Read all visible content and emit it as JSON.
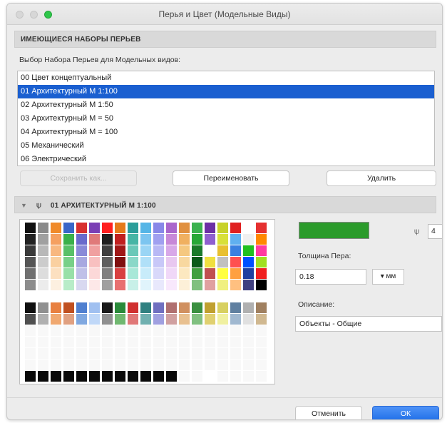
{
  "window": {
    "title": "Перья и Цвет (Модельные Виды)"
  },
  "sets_section": {
    "header": "ИМЕЮЩИЕСЯ НАБОРЫ ПЕРЬЕВ",
    "hint": "Выбор Набора Перьев для Модельных видов:",
    "items": [
      "00 Цвет концептуальный",
      "01 Архитектурный М 1:100",
      "02 Архитектурный М 1:50",
      "03 Архитектурный М = 50",
      "04 Архитектурный М = 100",
      "05 Механический",
      "06 Электрический"
    ],
    "selected_index": 1,
    "buttons": {
      "save_as": "Сохранить как...",
      "rename": "Переименовать",
      "delete": "Удалить"
    }
  },
  "pen_section": {
    "header": "01 АРХИТЕКТУРНЫЙ М 1:100",
    "current_color": "#2b9b2b",
    "pen_number": "4",
    "thickness_label": "Толщина Пера:",
    "thickness_value": "0.18",
    "unit": "мм",
    "description_label": "Описание:",
    "description_value": "Объекты - Общие"
  },
  "palette_rows": [
    [
      "#101010",
      "#8a8a8a",
      "#f08a2a",
      "#3a66c8",
      "#d83030",
      "#7b3fb5",
      "#ff2020",
      "#e57a1a",
      "#2a9d9a",
      "#55b5e6",
      "#8888e8",
      "#aa66cc",
      "#e09040",
      "#3bb24f",
      "#6c2fa5",
      "#c8d22a",
      "#e02020",
      "#ffffff",
      "#e53030"
    ],
    [
      "#222222",
      "#a0a0a0",
      "#f5a060",
      "#3ab04a",
      "#6a6acc",
      "#e07a7a",
      "#202020",
      "#c02020",
      "#46b5a5",
      "#7cc5f0",
      "#a0a0f0",
      "#c788d8",
      "#f0b060",
      "#28a838",
      "#8f5fcf",
      "#d8e03a",
      "#60b0f0",
      "#f0f0f0",
      "#ff8800"
    ],
    [
      "#3a3a3a",
      "#b8b8b8",
      "#f8b880",
      "#58c068",
      "#8a8ad8",
      "#f0a0a0",
      "#404040",
      "#a01818",
      "#6ac8b8",
      "#9ad5f5",
      "#b8b8f5",
      "#d8a8e8",
      "#f5c880",
      "#1a7a2a",
      "#ffffff",
      "#e8c030",
      "#3a80e0",
      "#20c020",
      "#ff3aa0"
    ],
    [
      "#555555",
      "#cccccc",
      "#fad0a0",
      "#78d088",
      "#a8a8e0",
      "#f8c0c0",
      "#606060",
      "#801010",
      "#8ad8c8",
      "#b0e0f8",
      "#c8c8f8",
      "#e8c8f0",
      "#f8d8a0",
      "#0a5a1a",
      "#f0e040",
      "#c0c0c0",
      "#ff5050",
      "#0050ff",
      "#a0e020"
    ],
    [
      "#707070",
      "#dddddd",
      "#fce0c0",
      "#98e0a8",
      "#c0c0e8",
      "#fcd8d8",
      "#808080",
      "#d84040",
      "#a8e8d8",
      "#c8ecfa",
      "#d8d8fa",
      "#f0d8f8",
      "#fce8c0",
      "#40a040",
      "#c05050",
      "#ffff40",
      "#ffa040",
      "#2040a0",
      "#f02020"
    ],
    [
      "#8c8c8c",
      "#ececec",
      "#fdf0e0",
      "#b8ecc8",
      "#d8d8f0",
      "#fde8e8",
      "#a0a0a0",
      "#e87070",
      "#c8f0e8",
      "#e0f4fc",
      "#e8e8fc",
      "#f8e8fc",
      "#fdf0d8",
      "#80c080",
      "#e0a0a0",
      "#f0f080",
      "#ffc080",
      "#404080",
      "#000000"
    ],
    [
      "#ffffff",
      "#ffffff",
      "#ffffff",
      "#ffffff",
      "#ffffff",
      "#ffffff",
      "#ffffff",
      "#ffffff",
      "#ffffff",
      "#ffffff",
      "#ffffff",
      "#ffffff",
      "#ffffff",
      "#ffffff",
      "#ffffff",
      "#ffffff",
      "#ffffff",
      "#ffffff",
      "#ffffff"
    ],
    [
      "#101010",
      "#909090",
      "#e88040",
      "#c05020",
      "#5080d0",
      "#a0c0f0",
      "#1a1a1a",
      "#2a8a3a",
      "#d03030",
      "#308080",
      "#7070c0",
      "#b07070",
      "#d09060",
      "#3a9040",
      "#c0a030",
      "#d8d060",
      "#6080a0",
      "#b0b0b0",
      "#a08060"
    ],
    [
      "#505050",
      "#b0b0b0",
      "#f0a870",
      "#e0a080",
      "#80a8e0",
      "#c0d8f8",
      "#909090",
      "#70b870",
      "#e07878",
      "#70b0b0",
      "#a0a0e0",
      "#d0a0a0",
      "#e8c090",
      "#80c080",
      "#e0d070",
      "#f0f0a0",
      "#a0b8d0",
      "#e0e0e0",
      "#d0b890"
    ],
    [
      "#f8f8f8",
      "#f8f8f8",
      "#f8f8f8",
      "#f8f8f8",
      "#f8f8f8",
      "#f8f8f8",
      "#f8f8f8",
      "#f8f8f8",
      "#f8f8f8",
      "#f8f8f8",
      "#f8f8f8",
      "#f8f8f8",
      "#f8f8f8",
      "#f8f8f8",
      "#f8f8f8",
      "#f8f8f8",
      "#f8f8f8",
      "#f8f8f8",
      "#f8f8f8"
    ],
    [
      "#f8f8f8",
      "#f8f8f8",
      "#f8f8f8",
      "#f8f8f8",
      "#f8f8f8",
      "#f8f8f8",
      "#f8f8f8",
      "#f8f8f8",
      "#f8f8f8",
      "#f8f8f8",
      "#f8f8f8",
      "#f8f8f8",
      "#f8f8f8",
      "#f8f8f8",
      "#f8f8f8",
      "#f8f8f8",
      "#f8f8f8",
      "#f8f8f8",
      "#f8f8f8"
    ],
    [
      "#f8f8f8",
      "#f8f8f8",
      "#f8f8f8",
      "#f8f8f8",
      "#f8f8f8",
      "#f8f8f8",
      "#f8f8f8",
      "#f8f8f8",
      "#f8f8f8",
      "#f8f8f8",
      "#f8f8f8",
      "#f8f8f8",
      "#f8f8f8",
      "#f8f8f8",
      "#f8f8f8",
      "#f8f8f8",
      "#f8f8f8",
      "#f8f8f8",
      "#f8f8f8"
    ],
    [
      "#f8f8f8",
      "#f8f8f8",
      "#f8f8f8",
      "#f8f8f8",
      "#f8f8f8",
      "#f8f8f8",
      "#f8f8f8",
      "#f8f8f8",
      "#f8f8f8",
      "#f8f8f8",
      "#f8f8f8",
      "#f8f8f8",
      "#f8f8f8",
      "#f8f8f8",
      "#f8f8f8",
      "#f8f8f8",
      "#f8f8f8",
      "#f8f8f8",
      "#f8f8f8"
    ],
    [
      "#0a0a0a",
      "#0a0a0a",
      "#0a0a0a",
      "#0a0a0a",
      "#0a0a0a",
      "#0a0a0a",
      "#0a0a0a",
      "#0a0a0a",
      "#0a0a0a",
      "#0a0a0a",
      "#0a0a0a",
      "#0a0a0a",
      "#f8f8f8",
      "#f8f8f8",
      "#ffffff",
      "#f8f8f8",
      "#f8f8f8",
      "#f8f8f8",
      "#f8f8f8"
    ]
  ],
  "footer": {
    "cancel": "Отменить",
    "ok": "ОК"
  }
}
